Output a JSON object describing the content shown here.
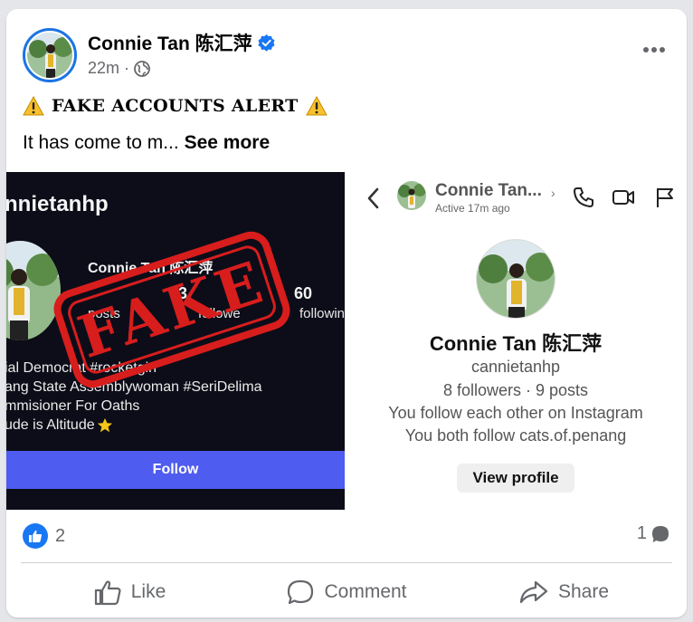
{
  "post": {
    "author": "Connie Tan 陈汇萍",
    "time": "22m",
    "title": "FAKE ACCOUNTS ALERT",
    "body_truncated": "It has come to m...",
    "see_more": "See more"
  },
  "screenshot_left": {
    "username": "nnietanhp",
    "display_name": "Connie Tan 陈汇萍",
    "stats": [
      {
        "value": "3",
        "label": "posts"
      },
      {
        "value": "60",
        "label": "followin"
      }
    ],
    "followers_label": "followe",
    "bio_lines": [
      "ial Democrat #rocketgirl",
      "ang State Assemblywoman #SeriDelima",
      "mmisioner For Oaths",
      "ude is Altitude"
    ],
    "follow_button": "Follow",
    "stamp": "FAKE"
  },
  "screenshot_right": {
    "name": "Connie Tan...",
    "active": "Active 17m ago",
    "profile_name": "Connie Tan 陈汇萍",
    "handle": "cannietanhp",
    "counts": "8 followers · 9 posts",
    "mutual_1": "You follow each other on Instagram",
    "mutual_2": "You both follow cats.of.penang",
    "view_profile": "View profile"
  },
  "reactions": {
    "like_count": "2",
    "comment_count": "1"
  },
  "actions": {
    "like": "Like",
    "comment": "Comment",
    "share": "Share"
  },
  "colors": {
    "facebook_blue": "#1877f2",
    "instagram_follow": "#4e5cf0",
    "stamp_red": "#d81d1d"
  }
}
